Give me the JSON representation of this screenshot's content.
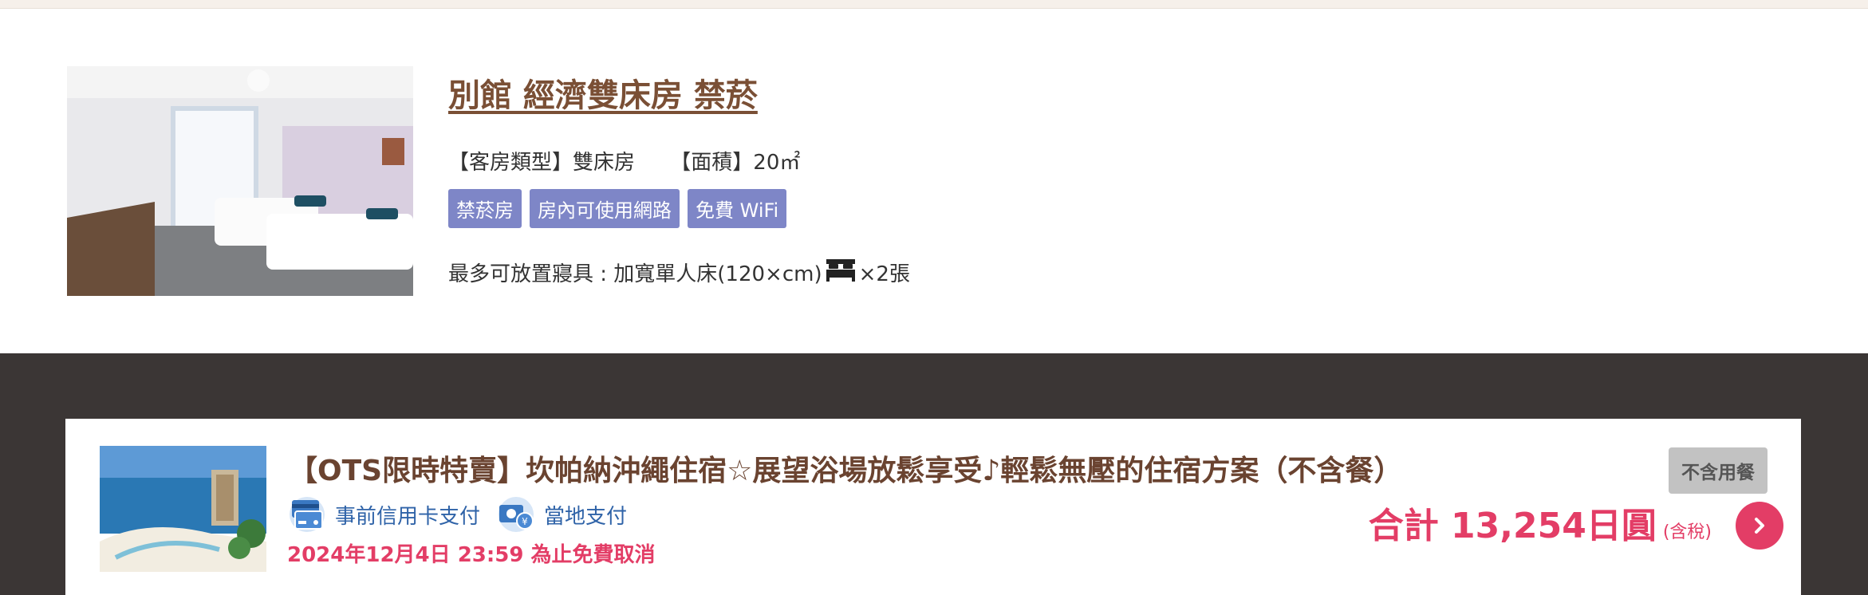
{
  "room": {
    "title": "別館 經濟雙床房 禁菸",
    "type_text": "【客房類型】雙床房",
    "area_text": "【面積】20㎡",
    "tags": [
      "禁菸房",
      "房內可使用網路",
      "免費 WiFi"
    ],
    "bedding_prefix": "最多可放置寢具 : 加寬單人床(120×cm)",
    "bedding_suffix": "×2張",
    "photo_icon": "hotel-room-photo"
  },
  "plan": {
    "title": "【OTS限時特賣】坎帕納沖繩住宿☆展望浴場放鬆享受♪輕鬆無壓的住宿方案（不含餐）",
    "meal_badge": "不含用餐",
    "payments": [
      "事前信用卡支付",
      "當地支付"
    ],
    "cancel_deadline": "2024年12月4日 23:59 為止免費取消",
    "price_total": "合計 13,254日圓",
    "price_tax": "(含稅)",
    "photo_icon": "beach-hotel-photo"
  },
  "colors": {
    "title_brown": "#7a4f35",
    "tag_purple": "#7e86c7",
    "accent_pink": "#e33d66",
    "payment_blue": "#2f63a8",
    "dark_bg": "#3b3635"
  }
}
